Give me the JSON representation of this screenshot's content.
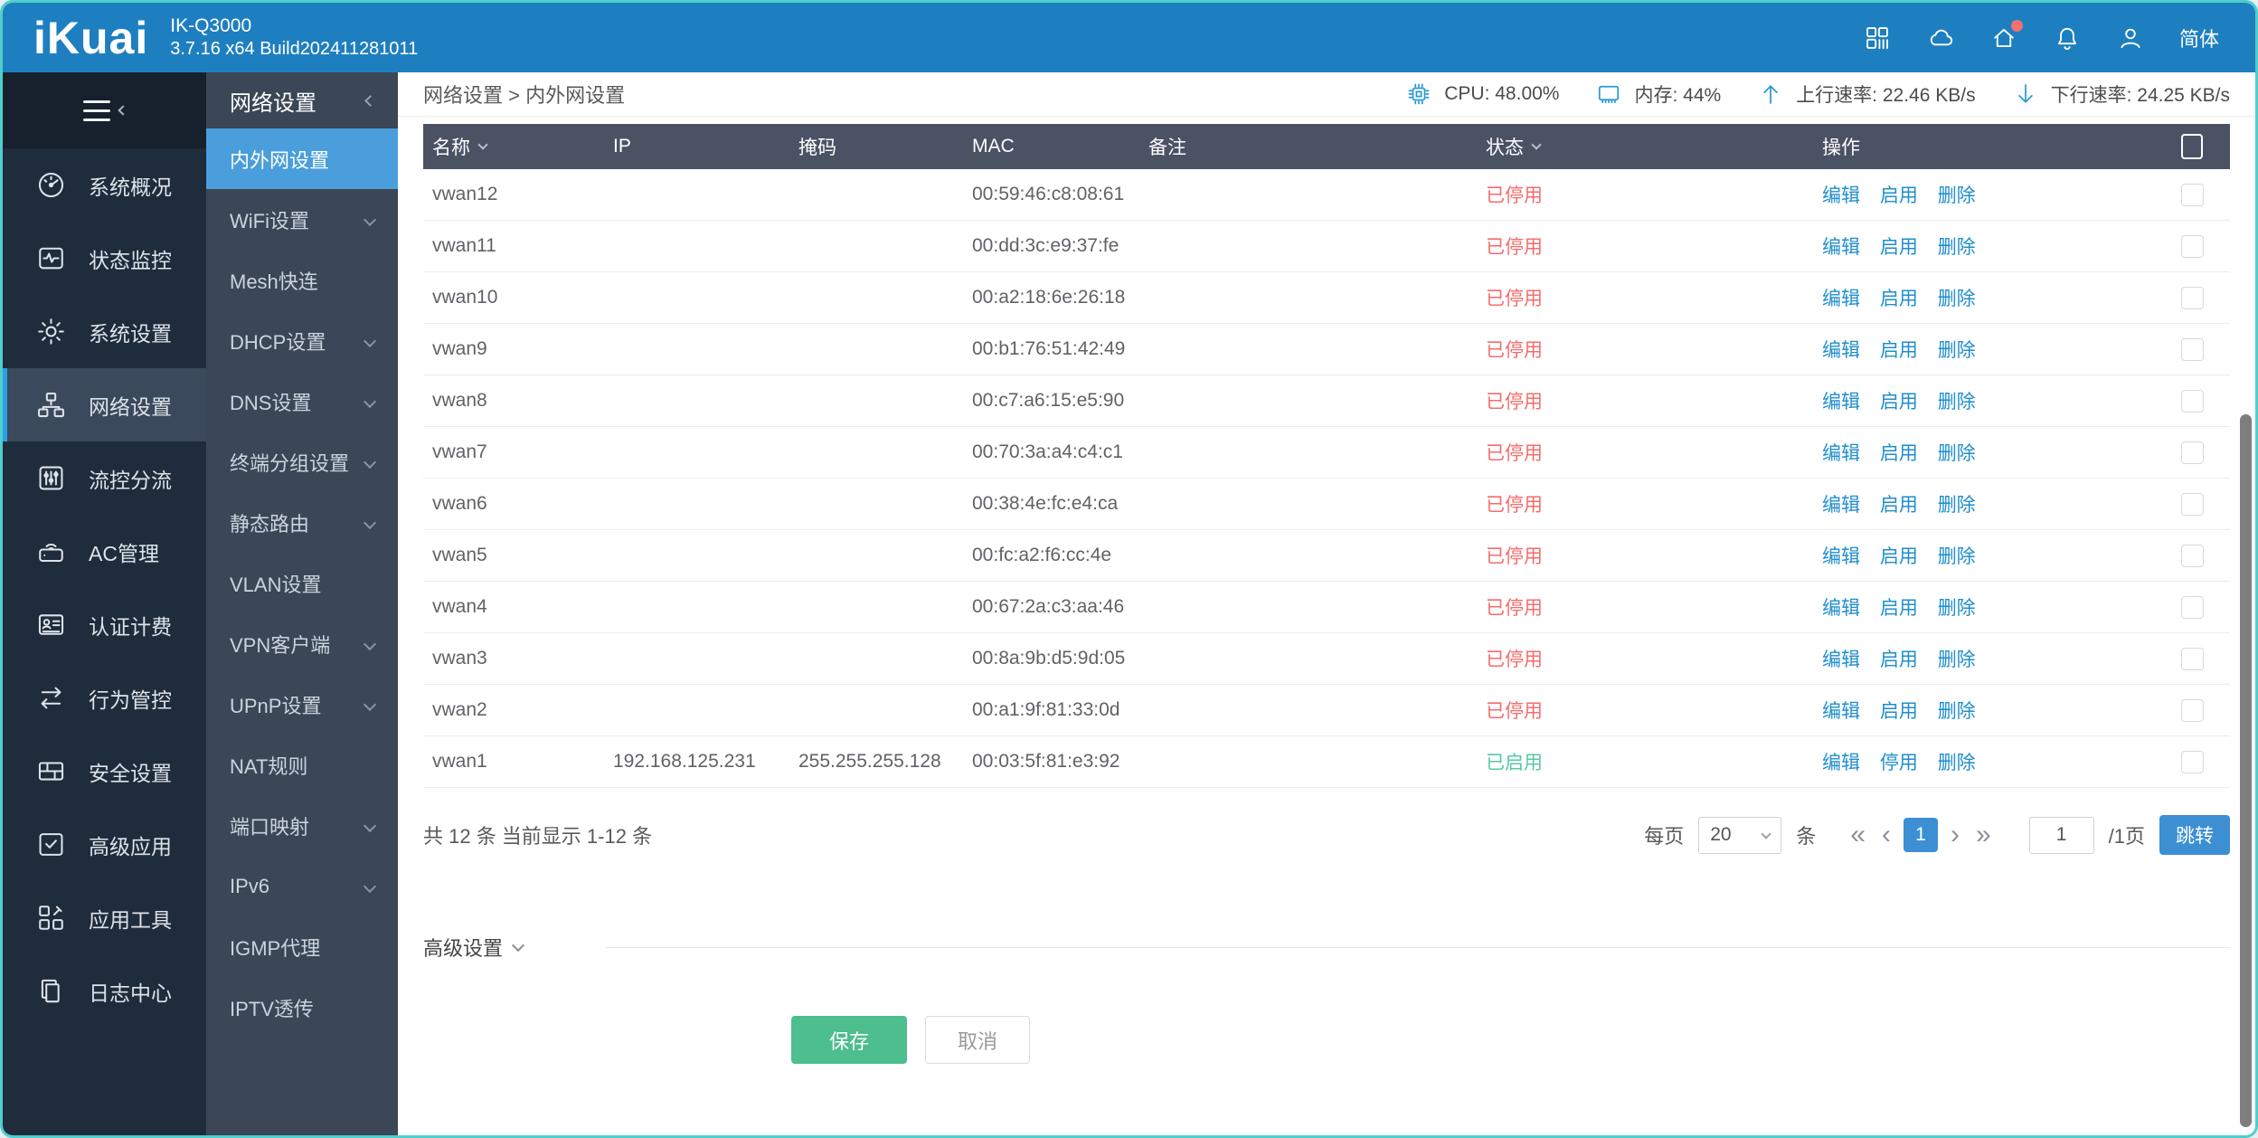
{
  "topbar": {
    "logo": "iKuai",
    "model": "IK-Q3000",
    "build": "3.7.16 x64 Build202411281011",
    "lang": "简体"
  },
  "sidebar": {
    "items": [
      {
        "label": "系统概况",
        "icon": "gauge-icon",
        "active": false
      },
      {
        "label": "状态监控",
        "icon": "monitor-icon",
        "active": false
      },
      {
        "label": "系统设置",
        "icon": "gear-icon",
        "active": false
      },
      {
        "label": "网络设置",
        "icon": "network-icon",
        "active": true
      },
      {
        "label": "流控分流",
        "icon": "sliders-icon",
        "active": false
      },
      {
        "label": "AC管理",
        "icon": "ap-icon",
        "active": false
      },
      {
        "label": "认证计费",
        "icon": "idcard-icon",
        "active": false
      },
      {
        "label": "行为管控",
        "icon": "arrows-swap-icon",
        "active": false
      },
      {
        "label": "安全设置",
        "icon": "firewall-icon",
        "active": false
      },
      {
        "label": "高级应用",
        "icon": "check-square-icon",
        "active": false
      },
      {
        "label": "应用工具",
        "icon": "tools-icon",
        "active": false
      },
      {
        "label": "日志中心",
        "icon": "logs-icon",
        "active": false
      }
    ]
  },
  "submenu": {
    "title": "网络设置",
    "items": [
      {
        "label": "内外网设置",
        "active": true,
        "expandable": false
      },
      {
        "label": "WiFi设置",
        "active": false,
        "expandable": true
      },
      {
        "label": "Mesh快连",
        "active": false,
        "expandable": false
      },
      {
        "label": "DHCP设置",
        "active": false,
        "expandable": true
      },
      {
        "label": "DNS设置",
        "active": false,
        "expandable": true
      },
      {
        "label": "终端分组设置",
        "active": false,
        "expandable": true
      },
      {
        "label": "静态路由",
        "active": false,
        "expandable": true
      },
      {
        "label": "VLAN设置",
        "active": false,
        "expandable": false
      },
      {
        "label": "VPN客户端",
        "active": false,
        "expandable": true
      },
      {
        "label": "UPnP设置",
        "active": false,
        "expandable": true
      },
      {
        "label": "NAT规则",
        "active": false,
        "expandable": false
      },
      {
        "label": "端口映射",
        "active": false,
        "expandable": true
      },
      {
        "label": "IPv6",
        "active": false,
        "expandable": true
      },
      {
        "label": "IGMP代理",
        "active": false,
        "expandable": false
      },
      {
        "label": "IPTV透传",
        "active": false,
        "expandable": false
      }
    ]
  },
  "breadcrumb": "网络设置 > 内外网设置",
  "stats": {
    "cpu": "CPU: 48.00%",
    "memory": "内存: 44%",
    "upload": "上行速率: 22.46 KB/s",
    "download": "下行速率: 24.25 KB/s"
  },
  "table": {
    "headers": [
      {
        "label": "名称",
        "sortable": true
      },
      {
        "label": "IP",
        "sortable": false
      },
      {
        "label": "掩码",
        "sortable": false
      },
      {
        "label": "MAC",
        "sortable": false
      },
      {
        "label": "备注",
        "sortable": false
      },
      {
        "label": "状态",
        "sortable": true
      },
      {
        "label": "操作",
        "sortable": false
      }
    ],
    "rows": [
      {
        "name": "vwan12",
        "ip": "",
        "mask": "",
        "mac": "00:59:46:c8:08:61",
        "note": "",
        "status": "已停用",
        "status_type": "status-off",
        "actions": [
          "编辑",
          "启用",
          "删除"
        ]
      },
      {
        "name": "vwan11",
        "ip": "",
        "mask": "",
        "mac": "00:dd:3c:e9:37:fe",
        "note": "",
        "status": "已停用",
        "status_type": "status-off",
        "actions": [
          "编辑",
          "启用",
          "删除"
        ]
      },
      {
        "name": "vwan10",
        "ip": "",
        "mask": "",
        "mac": "00:a2:18:6e:26:18",
        "note": "",
        "status": "已停用",
        "status_type": "status-off",
        "actions": [
          "编辑",
          "启用",
          "删除"
        ]
      },
      {
        "name": "vwan9",
        "ip": "",
        "mask": "",
        "mac": "00:b1:76:51:42:49",
        "note": "",
        "status": "已停用",
        "status_type": "status-off",
        "actions": [
          "编辑",
          "启用",
          "删除"
        ]
      },
      {
        "name": "vwan8",
        "ip": "",
        "mask": "",
        "mac": "00:c7:a6:15:e5:90",
        "note": "",
        "status": "已停用",
        "status_type": "status-off",
        "actions": [
          "编辑",
          "启用",
          "删除"
        ]
      },
      {
        "name": "vwan7",
        "ip": "",
        "mask": "",
        "mac": "00:70:3a:a4:c4:c1",
        "note": "",
        "status": "已停用",
        "status_type": "status-off",
        "actions": [
          "编辑",
          "启用",
          "删除"
        ]
      },
      {
        "name": "vwan6",
        "ip": "",
        "mask": "",
        "mac": "00:38:4e:fc:e4:ca",
        "note": "",
        "status": "已停用",
        "status_type": "status-off",
        "actions": [
          "编辑",
          "启用",
          "删除"
        ]
      },
      {
        "name": "vwan5",
        "ip": "",
        "mask": "",
        "mac": "00:fc:a2:f6:cc:4e",
        "note": "",
        "status": "已停用",
        "status_type": "status-off",
        "actions": [
          "编辑",
          "启用",
          "删除"
        ]
      },
      {
        "name": "vwan4",
        "ip": "",
        "mask": "",
        "mac": "00:67:2a:c3:aa:46",
        "note": "",
        "status": "已停用",
        "status_type": "status-off",
        "actions": [
          "编辑",
          "启用",
          "删除"
        ]
      },
      {
        "name": "vwan3",
        "ip": "",
        "mask": "",
        "mac": "00:8a:9b:d5:9d:05",
        "note": "",
        "status": "已停用",
        "status_type": "status-off",
        "actions": [
          "编辑",
          "启用",
          "删除"
        ]
      },
      {
        "name": "vwan2",
        "ip": "",
        "mask": "",
        "mac": "00:a1:9f:81:33:0d",
        "note": "",
        "status": "已停用",
        "status_type": "status-off",
        "actions": [
          "编辑",
          "启用",
          "删除"
        ]
      },
      {
        "name": "vwan1",
        "ip": "192.168.125.231",
        "mask": "255.255.255.128",
        "mac": "00:03:5f:81:e3:92",
        "note": "",
        "status": "已启用",
        "status_type": "status-on",
        "actions": [
          "编辑",
          "停用",
          "删除"
        ]
      }
    ]
  },
  "pagination": {
    "summary": "共 12 条 当前显示 1-12 条",
    "per_page_label": "每页",
    "per_page_value": "20",
    "unit_label": "条",
    "first": "«",
    "prev": "‹",
    "current_page": "1",
    "next": "›",
    "last": "»",
    "page_input": "1",
    "page_total_label": "/1页",
    "jump_label": "跳转"
  },
  "advanced_label": "高级设置",
  "footer_buttons": {
    "save": "保存",
    "cancel": "取消"
  },
  "colors": {
    "topbar": "#1e7fc0",
    "window_border": "#4ecfcb",
    "sidebar": "#1f2c3c",
    "submenu": "#3b4757",
    "submenu_active": "#4a9edb",
    "table_header": "#4a5264",
    "status_disabled": "#f56c6c",
    "status_enabled": "#57c9a1",
    "action_link": "#1f8ecd",
    "save_button": "#4dbe8e",
    "page_button": "#3d8fd4"
  }
}
